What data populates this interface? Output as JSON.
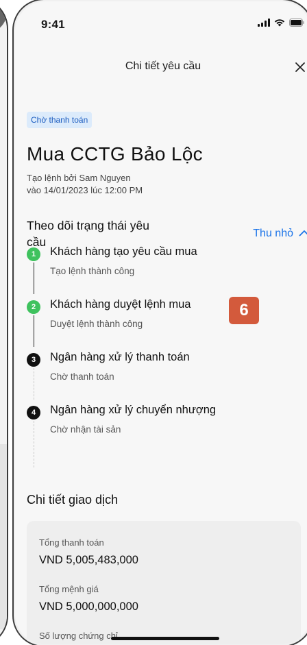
{
  "status_bar": {
    "time": "9:41"
  },
  "nav": {
    "title": "Chi tiết yêu cầu"
  },
  "order": {
    "status": "Chờ thanh toán",
    "title": "Mua CCTG Bảo Lộc",
    "created_by": "Tạo lệnh bởi Sam Nguyen",
    "created_at": "vào 14/01/2023 lúc 12:00 PM"
  },
  "tracking": {
    "title": "Theo dõi trạng thái yêu cầu",
    "collapse_label": "Thu nhỏ",
    "steps": [
      {
        "number": "1",
        "title": "Khách hàng tạo yêu cầu mua",
        "subtitle": "Tạo lệnh thành công",
        "state": "done"
      },
      {
        "number": "2",
        "title": "Khách hàng duyệt lệnh mua",
        "subtitle": "Duyệt lệnh thành công",
        "state": "done"
      },
      {
        "number": "3",
        "title": "Ngân hàng xử lý thanh toán",
        "subtitle": "Chờ thanh toán",
        "state": "pending"
      },
      {
        "number": "4",
        "title": "Ngân hàng xử lý chuyển nhượng",
        "subtitle": "Chờ nhận tài sản",
        "state": "pending"
      }
    ],
    "annotation_badge": "6"
  },
  "details": {
    "title": "Chi tiết giao dịch",
    "rows": [
      {
        "label": "Tổng thanh toán",
        "value": "VND 5,005,483,000"
      },
      {
        "label": "Tổng mệnh giá",
        "value": "VND 5,000,000,000"
      },
      {
        "label": "Số lượng chứng chỉ",
        "value": ""
      }
    ]
  },
  "colors": {
    "accent": "#1a73e8",
    "success": "#3fc25e",
    "badge_bg": "#dcebfb",
    "annotation": "#d35a3c"
  },
  "icons": {
    "close": "close-icon",
    "collapse": "chevron-up-icon",
    "signal": "signal-icon",
    "wifi": "wifi-icon",
    "battery": "battery-icon"
  }
}
